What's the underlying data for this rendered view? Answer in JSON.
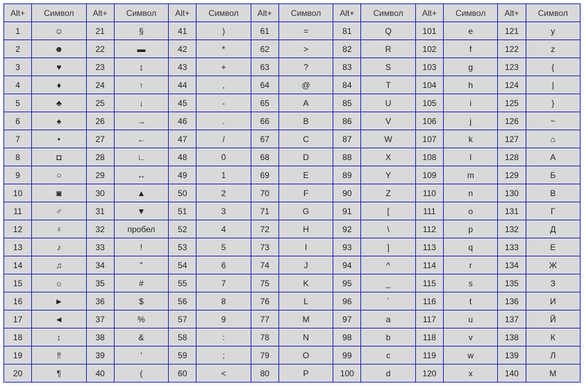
{
  "headers": {
    "alt": "Alt+",
    "symbol": "Символ"
  },
  "columns": [
    {
      "rows": [
        {
          "alt": "1",
          "sym": "☺"
        },
        {
          "alt": "2",
          "sym": "☻"
        },
        {
          "alt": "3",
          "sym": "♥"
        },
        {
          "alt": "4",
          "sym": "♦"
        },
        {
          "alt": "5",
          "sym": "♣"
        },
        {
          "alt": "6",
          "sym": "♠"
        },
        {
          "alt": "7",
          "sym": "•"
        },
        {
          "alt": "8",
          "sym": "◘"
        },
        {
          "alt": "9",
          "sym": "○"
        },
        {
          "alt": "10",
          "sym": "◙"
        },
        {
          "alt": "11",
          "sym": "♂"
        },
        {
          "alt": "12",
          "sym": "♀"
        },
        {
          "alt": "13",
          "sym": "♪"
        },
        {
          "alt": "14",
          "sym": "♫"
        },
        {
          "alt": "15",
          "sym": "☼"
        },
        {
          "alt": "16",
          "sym": "►"
        },
        {
          "alt": "17",
          "sym": "◄"
        },
        {
          "alt": "18",
          "sym": "↕"
        },
        {
          "alt": "19",
          "sym": "‼"
        },
        {
          "alt": "20",
          "sym": "¶"
        }
      ]
    },
    {
      "rows": [
        {
          "alt": "21",
          "sym": "§"
        },
        {
          "alt": "22",
          "sym": "▬"
        },
        {
          "alt": "23",
          "sym": "↨"
        },
        {
          "alt": "24",
          "sym": "↑"
        },
        {
          "alt": "25",
          "sym": "↓"
        },
        {
          "alt": "26",
          "sym": "→"
        },
        {
          "alt": "27",
          "sym": "←"
        },
        {
          "alt": "28",
          "sym": "∟"
        },
        {
          "alt": "29",
          "sym": "↔"
        },
        {
          "alt": "30",
          "sym": "▲"
        },
        {
          "alt": "31",
          "sym": "▼"
        },
        {
          "alt": "32",
          "sym": "пробел"
        },
        {
          "alt": "33",
          "sym": "!"
        },
        {
          "alt": "34",
          "sym": "\""
        },
        {
          "alt": "35",
          "sym": "#"
        },
        {
          "alt": "36",
          "sym": "$"
        },
        {
          "alt": "37",
          "sym": "%"
        },
        {
          "alt": "38",
          "sym": "&"
        },
        {
          "alt": "39",
          "sym": "'"
        },
        {
          "alt": "40",
          "sym": "("
        }
      ]
    },
    {
      "rows": [
        {
          "alt": "41",
          "sym": ")"
        },
        {
          "alt": "42",
          "sym": "*"
        },
        {
          "alt": "43",
          "sym": "+"
        },
        {
          "alt": "44",
          "sym": ","
        },
        {
          "alt": "45",
          "sym": "-"
        },
        {
          "alt": "46",
          "sym": "."
        },
        {
          "alt": "47",
          "sym": "/"
        },
        {
          "alt": "48",
          "sym": "0"
        },
        {
          "alt": "49",
          "sym": "1"
        },
        {
          "alt": "50",
          "sym": "2"
        },
        {
          "alt": "51",
          "sym": "3"
        },
        {
          "alt": "52",
          "sym": "4"
        },
        {
          "alt": "53",
          "sym": "5"
        },
        {
          "alt": "54",
          "sym": "6"
        },
        {
          "alt": "55",
          "sym": "7"
        },
        {
          "alt": "56",
          "sym": "8"
        },
        {
          "alt": "57",
          "sym": "9"
        },
        {
          "alt": "58",
          "sym": ":"
        },
        {
          "alt": "59",
          "sym": ";"
        },
        {
          "alt": "60",
          "sym": "<"
        }
      ]
    },
    {
      "rows": [
        {
          "alt": "61",
          "sym": "="
        },
        {
          "alt": "62",
          "sym": ">"
        },
        {
          "alt": "63",
          "sym": "?"
        },
        {
          "alt": "64",
          "sym": "@"
        },
        {
          "alt": "65",
          "sym": "A"
        },
        {
          "alt": "66",
          "sym": "B"
        },
        {
          "alt": "67",
          "sym": "C"
        },
        {
          "alt": "68",
          "sym": "D"
        },
        {
          "alt": "69",
          "sym": "E"
        },
        {
          "alt": "70",
          "sym": "F"
        },
        {
          "alt": "71",
          "sym": "G"
        },
        {
          "alt": "72",
          "sym": "H"
        },
        {
          "alt": "73",
          "sym": "I"
        },
        {
          "alt": "74",
          "sym": "J"
        },
        {
          "alt": "75",
          "sym": "K"
        },
        {
          "alt": "76",
          "sym": "L"
        },
        {
          "alt": "77",
          "sym": "M"
        },
        {
          "alt": "78",
          "sym": "N"
        },
        {
          "alt": "79",
          "sym": "O"
        },
        {
          "alt": "80",
          "sym": "P"
        }
      ]
    },
    {
      "rows": [
        {
          "alt": "81",
          "sym": "Q"
        },
        {
          "alt": "82",
          "sym": "R"
        },
        {
          "alt": "83",
          "sym": "S"
        },
        {
          "alt": "84",
          "sym": "T"
        },
        {
          "alt": "85",
          "sym": "U"
        },
        {
          "alt": "86",
          "sym": "V"
        },
        {
          "alt": "87",
          "sym": "W"
        },
        {
          "alt": "88",
          "sym": "X"
        },
        {
          "alt": "89",
          "sym": "Y"
        },
        {
          "alt": "90",
          "sym": "Z"
        },
        {
          "alt": "91",
          "sym": "["
        },
        {
          "alt": "92",
          "sym": "\\"
        },
        {
          "alt": "93",
          "sym": "]"
        },
        {
          "alt": "94",
          "sym": "^"
        },
        {
          "alt": "95",
          "sym": "_"
        },
        {
          "alt": "96",
          "sym": "`"
        },
        {
          "alt": "97",
          "sym": "a"
        },
        {
          "alt": "98",
          "sym": "b"
        },
        {
          "alt": "99",
          "sym": "c"
        },
        {
          "alt": "100",
          "sym": "d"
        }
      ]
    },
    {
      "rows": [
        {
          "alt": "101",
          "sym": "e"
        },
        {
          "alt": "102",
          "sym": "f"
        },
        {
          "alt": "103",
          "sym": "g"
        },
        {
          "alt": "104",
          "sym": "h"
        },
        {
          "alt": "105",
          "sym": "i"
        },
        {
          "alt": "106",
          "sym": "j"
        },
        {
          "alt": "107",
          "sym": "k"
        },
        {
          "alt": "108",
          "sym": "l"
        },
        {
          "alt": "109",
          "sym": "m"
        },
        {
          "alt": "110",
          "sym": "n"
        },
        {
          "alt": "111",
          "sym": "o"
        },
        {
          "alt": "112",
          "sym": "p"
        },
        {
          "alt": "113",
          "sym": "q"
        },
        {
          "alt": "114",
          "sym": "r"
        },
        {
          "alt": "115",
          "sym": "s"
        },
        {
          "alt": "116",
          "sym": "t"
        },
        {
          "alt": "117",
          "sym": "u"
        },
        {
          "alt": "118",
          "sym": "v"
        },
        {
          "alt": "119",
          "sym": "w"
        },
        {
          "alt": "120",
          "sym": "x"
        }
      ]
    },
    {
      "rows": [
        {
          "alt": "121",
          "sym": "y"
        },
        {
          "alt": "122",
          "sym": "z"
        },
        {
          "alt": "123",
          "sym": "{"
        },
        {
          "alt": "124",
          "sym": "|"
        },
        {
          "alt": "125",
          "sym": "}"
        },
        {
          "alt": "126",
          "sym": "~"
        },
        {
          "alt": "127",
          "sym": "⌂"
        },
        {
          "alt": "128",
          "sym": "А"
        },
        {
          "alt": "129",
          "sym": "Б"
        },
        {
          "alt": "130",
          "sym": "В"
        },
        {
          "alt": "131",
          "sym": "Г"
        },
        {
          "alt": "132",
          "sym": "Д"
        },
        {
          "alt": "133",
          "sym": "Е"
        },
        {
          "alt": "134",
          "sym": "Ж"
        },
        {
          "alt": "135",
          "sym": "З"
        },
        {
          "alt": "136",
          "sym": "И"
        },
        {
          "alt": "137",
          "sym": "Й"
        },
        {
          "alt": "138",
          "sym": "К"
        },
        {
          "alt": "139",
          "sym": "Л"
        },
        {
          "alt": "140",
          "sym": "М"
        }
      ]
    }
  ]
}
